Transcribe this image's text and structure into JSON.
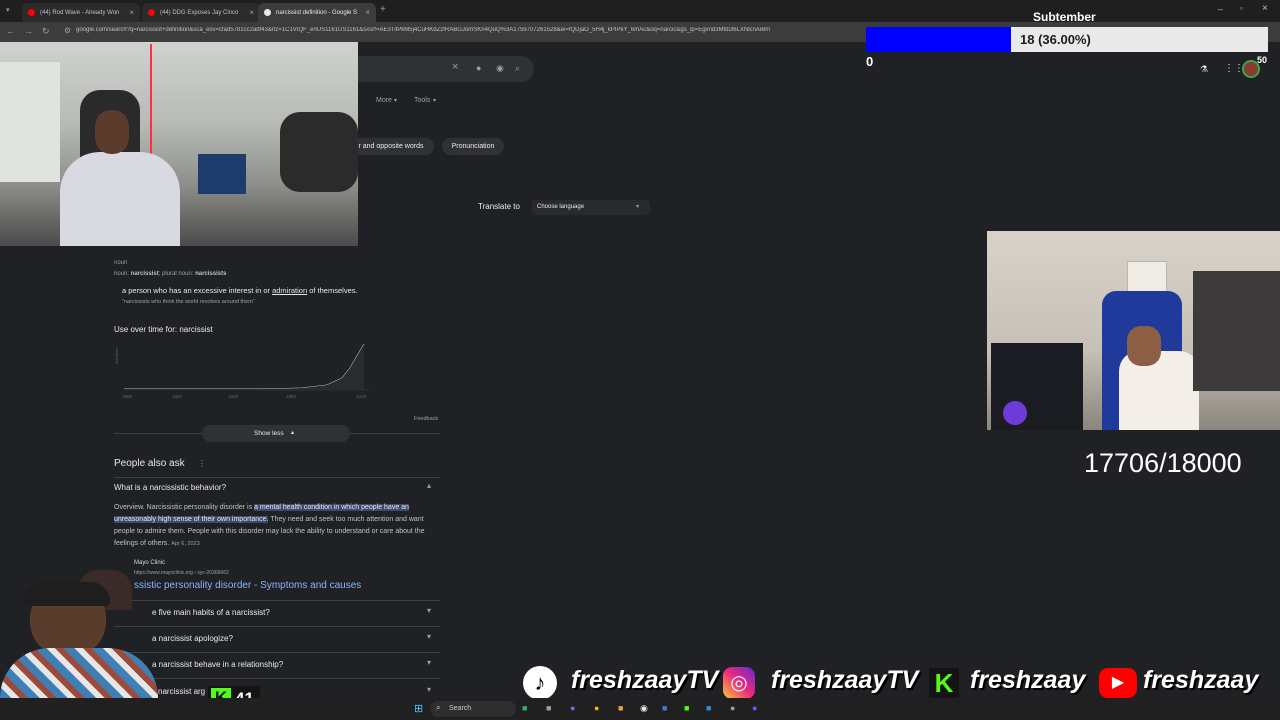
{
  "browser": {
    "tabs": [
      {
        "title": "(44) Rod Wave - Already Won"
      },
      {
        "title": "(44) DDG Exposes Jay Cinco"
      },
      {
        "title": "narcissist definition - Google S"
      }
    ],
    "url": "google.com/search?q=narcissist+definition&sca_esv=cfad5781cc2adf43&rlz=1C1VIQF_enUS1161US1161&sxsrf=AE3TifPkM5j4CuHKdZzfRABGJomSKn4QuQ%3A1759707261528&ei=fQDjaO_5H4j_kPIPkY_6mAc&oq=narcic&gs_lp=Egxnd3Mtd2l6LXNlcnAiBm"
  },
  "search": {
    "more_label": "More",
    "tools_label": "Tools",
    "chips": [
      "r and opposite words",
      "Pronunciation"
    ],
    "translate_label": "Translate to",
    "translate_select": "Choose language"
  },
  "definition": {
    "part_of_speech": "noun",
    "forms_prefix": "noun:",
    "forms_word": "narcissist",
    "forms_plural_prefix": "; plural noun:",
    "forms_plural": "narcissists",
    "meaning_pre": "a person who has an excessive interest in or",
    "meaning_link": "admiration",
    "meaning_post": "of themselves.",
    "example": "\"narcissists who think the world revolves around them\""
  },
  "usage": {
    "title": "Use over time for: narcissist",
    "yaxis_label": "Mentions",
    "x_ticks": [
      "1800",
      "1850",
      "1900",
      "1950",
      "2019"
    ],
    "feedback": "Feedback",
    "show_less": "Show less"
  },
  "paa": {
    "title": "People also ask",
    "q1": "What is a narcissistic behavior?",
    "answer_pre": "Overview. Narcissistic personality disorder is",
    "answer_hl": "a mental health condition in which people have an unreasonably high sense of their own importance.",
    "answer_post": "They need and seek too much attention and want people to admire them. People with this disorder may lack the ability to understand or care about the feelings of others.",
    "answer_date": "Apr 6, 2023",
    "source_name": "Mayo Clinic",
    "source_url": "https://www.mayoclinic.org › syc-20366662",
    "source_title": "ssistic personality disorder - Symptoms and causes",
    "q2": "e five main habits of a narcissist?",
    "q3": "a narcissist apologize?",
    "q4": "a narcissist behave in a relationship?",
    "q5": "narcissist arg"
  },
  "overlay": {
    "goal_title": "Subtember",
    "goal_text": "18 (36.00%)",
    "goal_progress": 0.36,
    "goal_left_value": "0",
    "goal_right_value": "50",
    "counter": "17706/18000",
    "kick_count": "41",
    "social_handles": [
      "freshzaayTV",
      "freshzaayTV",
      "freshzaay",
      "freshzaay"
    ]
  },
  "taskbar": {
    "search_label": "Search"
  },
  "colors": {
    "page_bg": "#202124",
    "progress_fill": "#0000ff",
    "link": "#8ab4f8",
    "highlight": "#3c4a6e",
    "kick_green": "#53fc18"
  }
}
